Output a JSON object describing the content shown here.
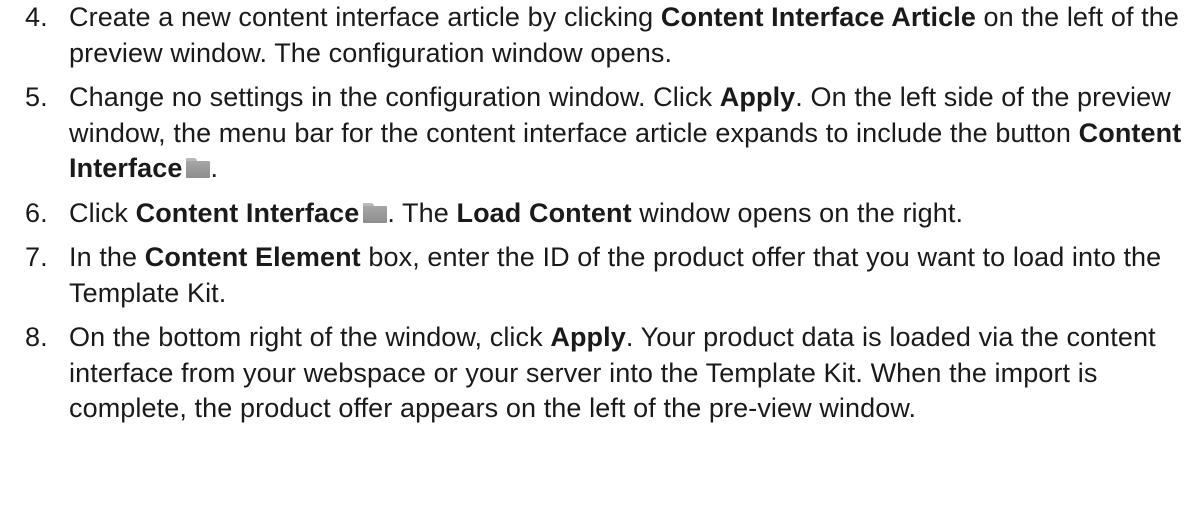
{
  "steps": [
    {
      "number": "4.",
      "parts": [
        "Create a new content interface article by clicking ",
        "Content Interface Article",
        " on the left of the preview window. The configuration window opens."
      ]
    },
    {
      "number": "5.",
      "parts": [
        "Change no settings in the configuration window. Click ",
        "Apply",
        ". On the left side of the preview window, the menu bar for the content interface article expands to include the button ",
        "Content Interface",
        "."
      ]
    },
    {
      "number": "6.",
      "parts": [
        "Click ",
        "Content Interface",
        ". The ",
        "Load Content",
        " window opens on the right."
      ]
    },
    {
      "number": "7.",
      "parts": [
        "In the ",
        "Content Element",
        " box, enter the ID of the product offer that you want to load into the Template Kit."
      ]
    },
    {
      "number": "8.",
      "parts": [
        "On the bottom right of the window, click ",
        "Apply",
        ". Your product data is loaded via the content interface from your webspace or your server into the Template Kit. When the import is complete, the product offer appears on the left of the pre-view window."
      ]
    }
  ],
  "icons": {
    "content_interface_icon": "folder-icon"
  }
}
